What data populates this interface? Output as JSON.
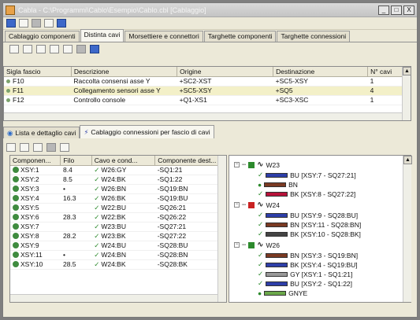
{
  "window": {
    "title": "Cabla - C:\\Programmi\\Cablo\\Esempio\\Cablo.cbl [Cablaggio]",
    "buttons": [
      "_",
      "□",
      "X"
    ]
  },
  "tabs": [
    {
      "label": "Cablaggio componenti",
      "active": false
    },
    {
      "label": "Distinta cavi",
      "active": true
    },
    {
      "label": "Morsettiere e connettori",
      "active": false
    },
    {
      "label": "Targhette componenti",
      "active": false
    },
    {
      "label": "Targhette connessioni",
      "active": false
    }
  ],
  "top_table": {
    "headers": [
      "Sigla fascio",
      "Descrizione",
      "Origine",
      "Destinazione",
      "N° cavi"
    ],
    "rows": [
      {
        "sigla": "F10",
        "descr": "Raccolta consensi asse Y",
        "orig": "+SC2-XST",
        "dest": "+SC5-XSY",
        "n": "1",
        "selected": false
      },
      {
        "sigla": "F11",
        "descr": "Collegamento sensori asse Y",
        "orig": "+SC5-XSY",
        "dest": "+SQ5",
        "n": "4",
        "selected": true
      },
      {
        "sigla": "F12",
        "descr": "Controllo console",
        "orig": "+Q1-XS1",
        "dest": "+SC3-XSC",
        "n": "1",
        "selected": false
      }
    ]
  },
  "bottom_tabs": [
    {
      "label": "Lista e dettaglio cavi",
      "active": false
    },
    {
      "label": "Cablaggio connessioni per fascio di cavi",
      "active": true
    }
  ],
  "left_table": {
    "headers": [
      "Componen...",
      "Filo",
      "Cavo e cond...",
      "Componente dest..."
    ],
    "rows": [
      [
        "XSY:1",
        "8.4",
        "W26:GY",
        "-SQ1:21"
      ],
      [
        "XSY:2",
        "8.5",
        "W24:BK",
        "-SQ1:22"
      ],
      [
        "XSY:3",
        "•",
        "W26:BN",
        "-SQ19:BN"
      ],
      [
        "XSY:4",
        "16.3",
        "W26:BK",
        "-SQ19:BU"
      ],
      [
        "XSY:5",
        "",
        "W22:BU",
        "-SQ26:21"
      ],
      [
        "XSY:6",
        "28.3",
        "W22:BK",
        "-SQ26:22"
      ],
      [
        "XSY:7",
        "",
        "W23:BU",
        "-SQ27:21"
      ],
      [
        "XSY:8",
        "28.2",
        "W23:BK",
        "-SQ27:22"
      ],
      [
        "XSY:9",
        "",
        "W24:BU",
        "-SQ28:BU"
      ],
      [
        "XSY:11",
        "•",
        "W24:BN",
        "-SQ28:BN"
      ],
      [
        "XSY:10",
        "28.5",
        "W24:BK",
        "-SQ28:BK"
      ]
    ]
  },
  "tree": {
    "groups": [
      {
        "name": "W23",
        "color": "#2d8a2d",
        "wires": [
          {
            "color": "#2d3ea8",
            "label": "BU [XSY:7 - SQ27:21]",
            "dot": false
          },
          {
            "color": "#7a3a22",
            "label": "BN",
            "dot": true
          },
          {
            "color": "#b8123a",
            "label": "BK [XSY:8 - SQ27:22]",
            "dot": false
          }
        ]
      },
      {
        "name": "W24",
        "color": "#c92222",
        "wires": [
          {
            "color": "#2d3ea8",
            "label": "BU [XSY:9 - SQ28:BU]",
            "dot": false
          },
          {
            "color": "#7a3a22",
            "label": "BN [XSY:11 - SQ28:BN]",
            "dot": false
          },
          {
            "color": "#444444",
            "label": "BK [XSY:10 - SQ28:BK]",
            "dot": false
          }
        ]
      },
      {
        "name": "W26",
        "color": "#2d8a2d",
        "wires": [
          {
            "color": "#7a3a22",
            "label": "BN [XSY:3 - SQ19:BN]",
            "dot": false
          },
          {
            "color": "#2d3ea8",
            "label": "BK [XSY:4 - SQ19:BU]",
            "dot": false
          },
          {
            "color": "#999999",
            "label": "GY [XSY:1 - SQ1:21]",
            "dot": false
          },
          {
            "color": "#2d3ea8",
            "label": "BU [XSY:2 - SQ1:22]",
            "dot": false
          },
          {
            "color": "#6ba84a",
            "label": "GNYE",
            "dot": true
          }
        ]
      }
    ]
  }
}
